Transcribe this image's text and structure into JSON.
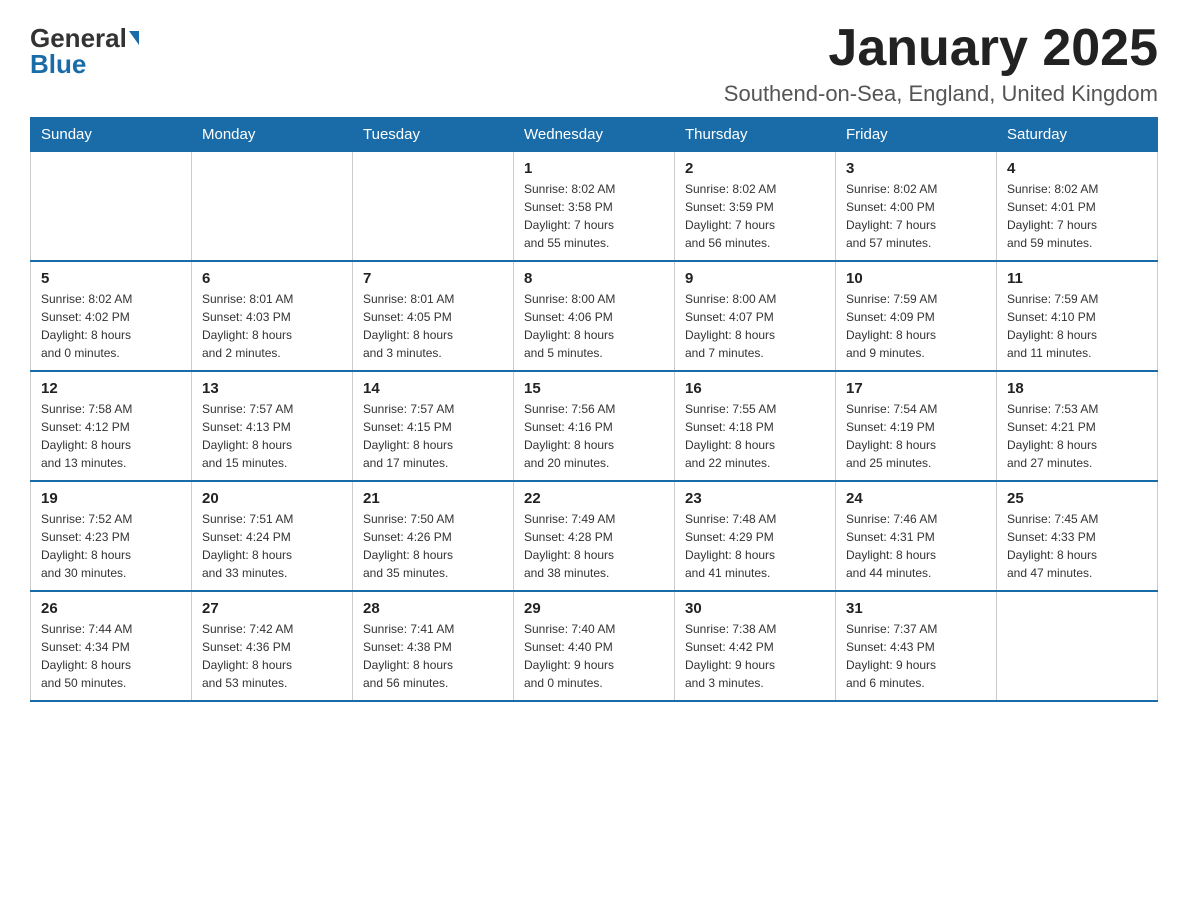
{
  "logo": {
    "general": "General",
    "blue": "Blue"
  },
  "title": "January 2025",
  "location": "Southend-on-Sea, England, United Kingdom",
  "days_of_week": [
    "Sunday",
    "Monday",
    "Tuesday",
    "Wednesday",
    "Thursday",
    "Friday",
    "Saturday"
  ],
  "weeks": [
    [
      {
        "day": "",
        "info": ""
      },
      {
        "day": "",
        "info": ""
      },
      {
        "day": "",
        "info": ""
      },
      {
        "day": "1",
        "info": "Sunrise: 8:02 AM\nSunset: 3:58 PM\nDaylight: 7 hours\nand 55 minutes."
      },
      {
        "day": "2",
        "info": "Sunrise: 8:02 AM\nSunset: 3:59 PM\nDaylight: 7 hours\nand 56 minutes."
      },
      {
        "day": "3",
        "info": "Sunrise: 8:02 AM\nSunset: 4:00 PM\nDaylight: 7 hours\nand 57 minutes."
      },
      {
        "day": "4",
        "info": "Sunrise: 8:02 AM\nSunset: 4:01 PM\nDaylight: 7 hours\nand 59 minutes."
      }
    ],
    [
      {
        "day": "5",
        "info": "Sunrise: 8:02 AM\nSunset: 4:02 PM\nDaylight: 8 hours\nand 0 minutes."
      },
      {
        "day": "6",
        "info": "Sunrise: 8:01 AM\nSunset: 4:03 PM\nDaylight: 8 hours\nand 2 minutes."
      },
      {
        "day": "7",
        "info": "Sunrise: 8:01 AM\nSunset: 4:05 PM\nDaylight: 8 hours\nand 3 minutes."
      },
      {
        "day": "8",
        "info": "Sunrise: 8:00 AM\nSunset: 4:06 PM\nDaylight: 8 hours\nand 5 minutes."
      },
      {
        "day": "9",
        "info": "Sunrise: 8:00 AM\nSunset: 4:07 PM\nDaylight: 8 hours\nand 7 minutes."
      },
      {
        "day": "10",
        "info": "Sunrise: 7:59 AM\nSunset: 4:09 PM\nDaylight: 8 hours\nand 9 minutes."
      },
      {
        "day": "11",
        "info": "Sunrise: 7:59 AM\nSunset: 4:10 PM\nDaylight: 8 hours\nand 11 minutes."
      }
    ],
    [
      {
        "day": "12",
        "info": "Sunrise: 7:58 AM\nSunset: 4:12 PM\nDaylight: 8 hours\nand 13 minutes."
      },
      {
        "day": "13",
        "info": "Sunrise: 7:57 AM\nSunset: 4:13 PM\nDaylight: 8 hours\nand 15 minutes."
      },
      {
        "day": "14",
        "info": "Sunrise: 7:57 AM\nSunset: 4:15 PM\nDaylight: 8 hours\nand 17 minutes."
      },
      {
        "day": "15",
        "info": "Sunrise: 7:56 AM\nSunset: 4:16 PM\nDaylight: 8 hours\nand 20 minutes."
      },
      {
        "day": "16",
        "info": "Sunrise: 7:55 AM\nSunset: 4:18 PM\nDaylight: 8 hours\nand 22 minutes."
      },
      {
        "day": "17",
        "info": "Sunrise: 7:54 AM\nSunset: 4:19 PM\nDaylight: 8 hours\nand 25 minutes."
      },
      {
        "day": "18",
        "info": "Sunrise: 7:53 AM\nSunset: 4:21 PM\nDaylight: 8 hours\nand 27 minutes."
      }
    ],
    [
      {
        "day": "19",
        "info": "Sunrise: 7:52 AM\nSunset: 4:23 PM\nDaylight: 8 hours\nand 30 minutes."
      },
      {
        "day": "20",
        "info": "Sunrise: 7:51 AM\nSunset: 4:24 PM\nDaylight: 8 hours\nand 33 minutes."
      },
      {
        "day": "21",
        "info": "Sunrise: 7:50 AM\nSunset: 4:26 PM\nDaylight: 8 hours\nand 35 minutes."
      },
      {
        "day": "22",
        "info": "Sunrise: 7:49 AM\nSunset: 4:28 PM\nDaylight: 8 hours\nand 38 minutes."
      },
      {
        "day": "23",
        "info": "Sunrise: 7:48 AM\nSunset: 4:29 PM\nDaylight: 8 hours\nand 41 minutes."
      },
      {
        "day": "24",
        "info": "Sunrise: 7:46 AM\nSunset: 4:31 PM\nDaylight: 8 hours\nand 44 minutes."
      },
      {
        "day": "25",
        "info": "Sunrise: 7:45 AM\nSunset: 4:33 PM\nDaylight: 8 hours\nand 47 minutes."
      }
    ],
    [
      {
        "day": "26",
        "info": "Sunrise: 7:44 AM\nSunset: 4:34 PM\nDaylight: 8 hours\nand 50 minutes."
      },
      {
        "day": "27",
        "info": "Sunrise: 7:42 AM\nSunset: 4:36 PM\nDaylight: 8 hours\nand 53 minutes."
      },
      {
        "day": "28",
        "info": "Sunrise: 7:41 AM\nSunset: 4:38 PM\nDaylight: 8 hours\nand 56 minutes."
      },
      {
        "day": "29",
        "info": "Sunrise: 7:40 AM\nSunset: 4:40 PM\nDaylight: 9 hours\nand 0 minutes."
      },
      {
        "day": "30",
        "info": "Sunrise: 7:38 AM\nSunset: 4:42 PM\nDaylight: 9 hours\nand 3 minutes."
      },
      {
        "day": "31",
        "info": "Sunrise: 7:37 AM\nSunset: 4:43 PM\nDaylight: 9 hours\nand 6 minutes."
      },
      {
        "day": "",
        "info": ""
      }
    ]
  ]
}
